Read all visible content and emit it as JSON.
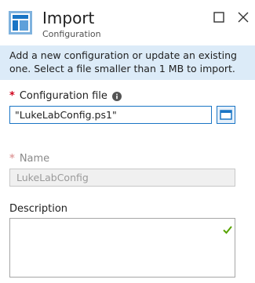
{
  "header": {
    "title": "Import",
    "subtitle": "Configuration",
    "icons": {
      "app": "configuration-blade-icon",
      "maximize": "maximize-icon",
      "close": "close-icon"
    }
  },
  "info_banner": {
    "text": "Add a new configuration or update an existing one. Select a file smaller than 1 MB to import."
  },
  "configuration_file": {
    "required_mark": "*",
    "label": "Configuration file",
    "value": "\"LukeLabConfig.ps1\"",
    "info_icon": "info-icon",
    "browse_icon": "folder-icon"
  },
  "name": {
    "required_mark": "*",
    "label": "Name",
    "value": "LukeLabConfig"
  },
  "description": {
    "label": "Description",
    "value": "",
    "status_icon": "checkmark-icon"
  },
  "colors": {
    "accent": "#1a75c5",
    "banner_bg": "#dcebf8",
    "required": "#d0021b",
    "valid": "#57a300"
  }
}
